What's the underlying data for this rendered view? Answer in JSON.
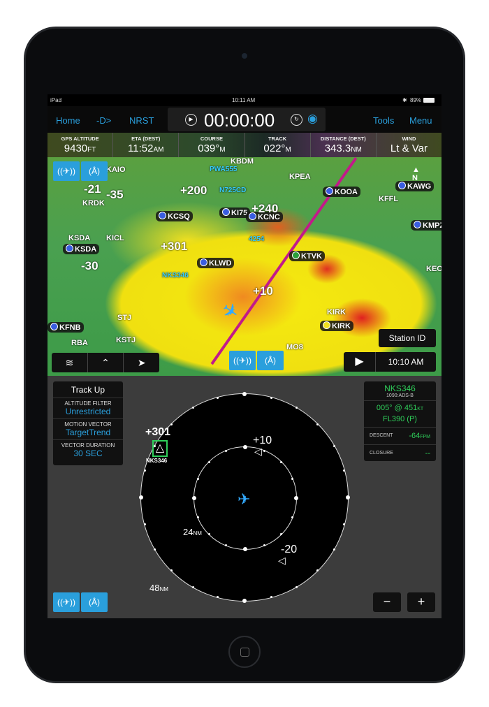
{
  "status_bar": {
    "device": "iPad",
    "time": "10:11 AM",
    "battery": "89%",
    "bluetooth_icon": "bluetooth-icon"
  },
  "nav": {
    "home": "Home",
    "direct_to": "-D>",
    "nrst": "NRST",
    "timer": "00:00:00",
    "tools": "Tools",
    "menu": "Menu"
  },
  "info_strip": [
    {
      "label": "GPS ALTITUDE",
      "value": "9430",
      "unit": "FT"
    },
    {
      "label": "ETA (DEST)",
      "value": "11:52",
      "unit": "AM"
    },
    {
      "label": "COURSE",
      "value": "039°",
      "unit": "M"
    },
    {
      "label": "TRACK",
      "value": "022°",
      "unit": "M"
    },
    {
      "label": "DISTANCE (DEST)",
      "value": "343.3",
      "unit": "NM"
    },
    {
      "label": "WIND",
      "value": "Lt & Var",
      "unit": ""
    }
  ],
  "map": {
    "airports": [
      "KAIO",
      "KRDK",
      "KSDA",
      "KICL",
      "KCSQ",
      "KI75",
      "KCNC",
      "KLWD",
      "KTVK",
      "KOOA",
      "KPEA",
      "KAWG",
      "KFFL",
      "KMPZ",
      "KIRK",
      "KFNB",
      "STJ",
      "KSTJ",
      "RBA",
      "MO8",
      "KBDM",
      "KEO"
    ],
    "traffic_tags": [
      "-21",
      "-35",
      "+200",
      "+240",
      "+301",
      "+10",
      "-30"
    ],
    "traffic_ids": [
      "PWA555",
      "N725CD",
      "NKS346",
      "4254"
    ],
    "north": "N",
    "station_id": "Station ID",
    "playback_time": "10:10 AM",
    "weather_colors": {
      "light": "#3d9b48",
      "moderate": "#f0e010",
      "heavy": "#f08a20",
      "extreme": "#e02020"
    },
    "route_color": "#c21a8a"
  },
  "traffic_view": {
    "orientation": "Track Up",
    "settings": [
      {
        "label": "ALTITUDE FILTER",
        "value": "Unrestricted"
      },
      {
        "label": "MOTION VECTOR",
        "value": "TargetTrend"
      },
      {
        "label": "VECTOR DURATION",
        "value": "30 SEC"
      }
    ],
    "target": {
      "id": "NKS346",
      "source": "1090:ADS-B",
      "track_speed": "005° @ 451",
      "speed_unit": "KT",
      "altitude": "FL390 (P)",
      "descent_label": "DESCENT",
      "descent": "-64",
      "descent_unit": "FPM",
      "closure_label": "CLOSURE",
      "closure": "--"
    },
    "targets": [
      "+301",
      "+10",
      "-20"
    ],
    "selected_target_id": "NKS346",
    "ranges": [
      {
        "value": "24",
        "unit": "NM"
      },
      {
        "value": "48",
        "unit": "NM"
      }
    ],
    "zoom_out": "−",
    "zoom_in": "+"
  },
  "accent": "#2a9fdc"
}
